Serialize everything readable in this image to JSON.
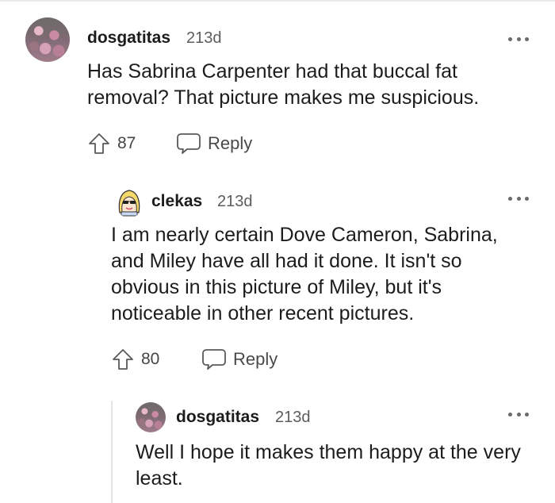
{
  "comments": [
    {
      "username": "dosgatitas",
      "time": "213d",
      "text": "Has Sabrina Carpenter had that buccal fat removal? That picture makes me suspicious.",
      "upvotes": "87",
      "reply_label": "Reply",
      "avatar_icon": "flower-avatar"
    },
    {
      "username": "clekas",
      "time": "213d",
      "text": "I am nearly certain Dove Cameron, Sabrina, and Miley have all had it done. It isn't so obvious in this picture of Miley, but it's noticeable in other recent pictures.",
      "upvotes": "80",
      "reply_label": "Reply",
      "avatar_icon": "cartoon-sunglasses-avatar"
    },
    {
      "username": "dosgatitas",
      "time": "213d",
      "text": "Well I hope it makes them happy at the very least.",
      "avatar_icon": "flower-avatar"
    }
  ],
  "icons": {
    "upvote": "arrow-up-outline-icon",
    "reply": "speech-bubble-icon",
    "more": "three-dots-icon"
  }
}
